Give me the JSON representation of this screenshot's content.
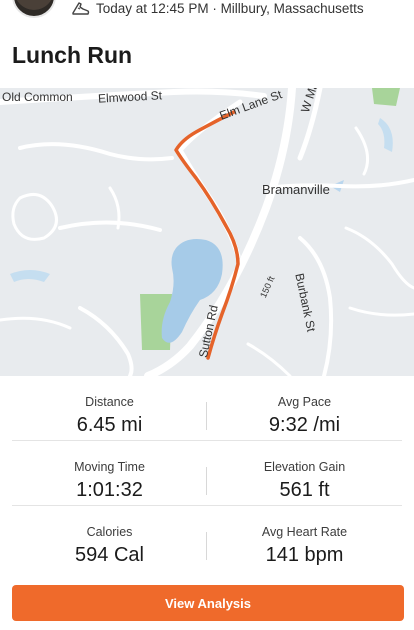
{
  "activity": {
    "meta": "Today at 12:45 PM · Millbury, Massachusetts",
    "title": "Lunch Run"
  },
  "map": {
    "labels": {
      "old_common": "Old Common",
      "elmwood": "Elmwood St",
      "elm_lane": "Elm Lane St",
      "w_main": "W Main St",
      "bramanville": "Bramanville",
      "burbank": "Burbank St",
      "route": "150 ft",
      "sutton": "Sutton Rd"
    },
    "route_color": "#e5632a"
  },
  "stats": [
    {
      "left": {
        "label": "Distance",
        "value": "6.45 mi"
      },
      "right": {
        "label": "Avg Pace",
        "value": "9:32 /mi"
      }
    },
    {
      "left": {
        "label": "Moving Time",
        "value": "1:01:32"
      },
      "right": {
        "label": "Elevation Gain",
        "value": "561 ft"
      }
    },
    {
      "left": {
        "label": "Calories",
        "value": "594 Cal"
      },
      "right": {
        "label": "Avg Heart Rate",
        "value": "141 bpm"
      }
    }
  ],
  "actions": {
    "view_analysis": "View Analysis"
  },
  "colors": {
    "accent": "#ef6a2b"
  },
  "icons": {
    "activity_type": "running-shoe-icon"
  }
}
